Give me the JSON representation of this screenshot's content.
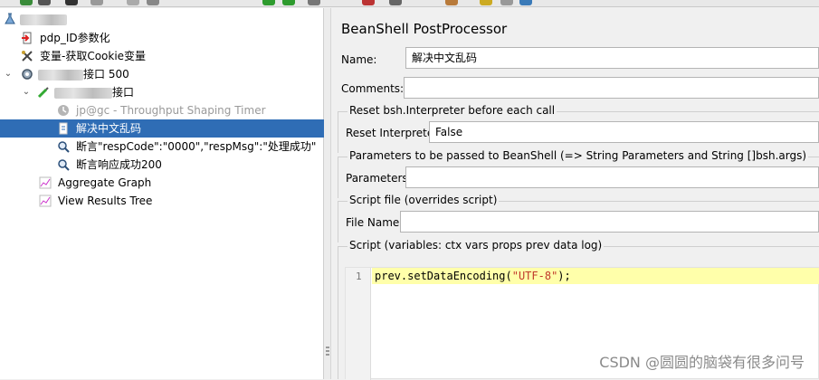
{
  "tree": {
    "test_plan": {
      "label_redacted": true
    },
    "items": [
      {
        "label": "pdp_ID参数化"
      },
      {
        "label": "变量-获取Cookie变量"
      },
      {
        "label_suffix": "接口  500"
      },
      {
        "label_suffix": "接口"
      },
      {
        "label": "jp@gc - Throughput Shaping Timer",
        "disabled": true
      },
      {
        "label": "解决中文乱码",
        "selected": true
      },
      {
        "label": "断言\"respCode\":\"0000\",\"respMsg\":\"处理成功\""
      },
      {
        "label": "断言响应成功200"
      },
      {
        "label": "Aggregate Graph"
      },
      {
        "label": "View Results Tree"
      }
    ]
  },
  "panel": {
    "title": "BeanShell PostProcessor",
    "name_label": "Name:",
    "name_value": "解决中文乱码",
    "comments_label": "Comments:",
    "comments_value": "",
    "reset_group_title": "Reset bsh.Interpreter before each call",
    "reset_label": "Reset Interpreter:",
    "reset_value": "False",
    "params_group_title": "Parameters to be passed to BeanShell (=> String Parameters and String []bsh.args)",
    "params_label": "Parameters:",
    "params_value": "",
    "script_file_group_title": "Script file (overrides script)",
    "file_name_label": "File Name:",
    "file_name_value": "",
    "script_group_title": "Script (variables: ctx vars props prev data log)",
    "script": {
      "line_number": "1",
      "code_prefix": "prev.setDataEncoding(",
      "code_string": "\"UTF-8\"",
      "code_suffix": ");"
    }
  },
  "watermark": "CSDN @圆圆的脑袋有很多问号",
  "colors": {
    "selection": "#2f6db5",
    "current_line": "#ffffaa"
  }
}
